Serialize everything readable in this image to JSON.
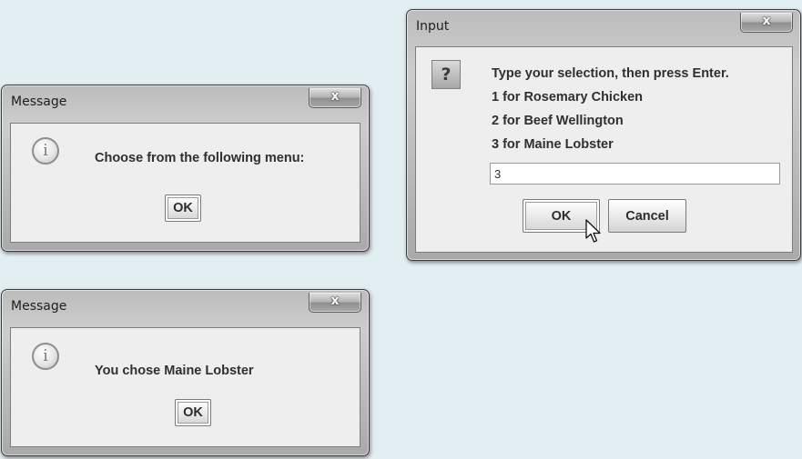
{
  "dialog_choose": {
    "title": "Message",
    "close_icon_glyph": "x",
    "icon": "information-icon",
    "icon_glyph": "i",
    "message": "Choose from the following menu:",
    "ok_label": "OK"
  },
  "dialog_input": {
    "title": "Input",
    "close_icon_glyph": "x",
    "icon": "question-icon",
    "icon_glyph": "?",
    "lines": [
      "Type your selection, then press Enter.",
      "1 for Rosemary Chicken",
      "2 for Beef Wellington",
      "3 for Maine Lobster"
    ],
    "input_value": "3",
    "ok_label": "OK",
    "cancel_label": "Cancel",
    "cursor": "mouse-pointer-icon"
  },
  "dialog_result": {
    "title": "Message",
    "close_icon_glyph": "x",
    "icon": "information-icon",
    "icon_glyph": "i",
    "message": "You chose Maine Lobster",
    "ok_label": "OK"
  },
  "colors": {
    "background": "#e2eef2",
    "frame": "#b3b3b3",
    "client": "#eeeeee",
    "text": "#2f2f2f"
  }
}
